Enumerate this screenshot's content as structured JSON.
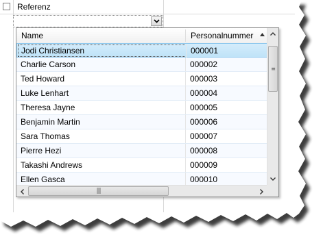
{
  "field": {
    "label": "Referenz",
    "combo_value": ""
  },
  "list": {
    "columns": [
      "Name",
      "Personalnummer"
    ],
    "rows": [
      {
        "name": "Jodi Christiansen",
        "number": "000001"
      },
      {
        "name": "Charlie Carson",
        "number": "000002"
      },
      {
        "name": "Ted Howard",
        "number": "000003"
      },
      {
        "name": "Luke Lenhart",
        "number": "000004"
      },
      {
        "name": "Theresa Jayne",
        "number": "000005"
      },
      {
        "name": "Benjamin Martin",
        "number": "000006"
      },
      {
        "name": "Sara Thomas",
        "number": "000007"
      },
      {
        "name": "Pierre Hezi",
        "number": "000008"
      },
      {
        "name": "Takashi Andrews",
        "number": "000009"
      },
      {
        "name": "Ellen Gasca",
        "number": "000010"
      }
    ],
    "selected_index": 0
  },
  "icons": {
    "combo_dropdown": "chevron-down-icon",
    "sort": "sort-ascending-icon",
    "scroll_up": "scroll-up-arrow-icon",
    "scroll_down": "scroll-down-arrow-icon",
    "scroll_left": "scroll-left-arrow-icon",
    "scroll_right": "scroll-right-arrow-icon"
  },
  "colors": {
    "selection": "#c7e7f9",
    "selection_border": "#8fc8ee"
  }
}
